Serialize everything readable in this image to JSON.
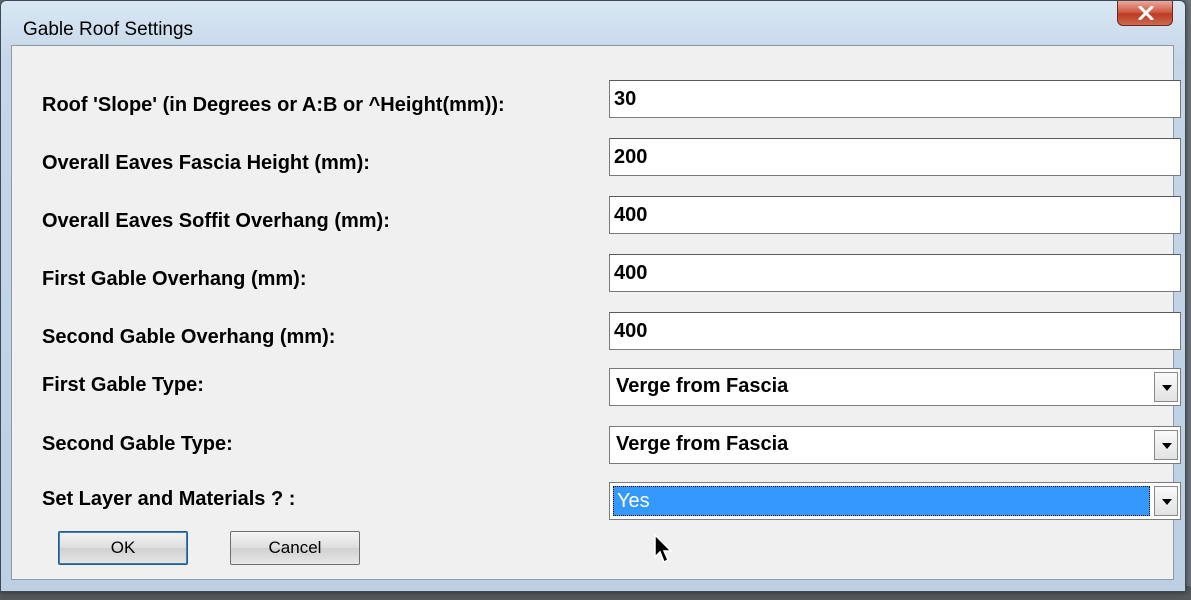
{
  "window": {
    "title": "Gable Roof Settings"
  },
  "fields": [
    {
      "label": "Roof 'Slope' (in Degrees or A:B or ^Height(mm)):",
      "value": "30"
    },
    {
      "label": "Overall Eaves Fascia Height (mm):",
      "value": "200"
    },
    {
      "label": "Overall Eaves Soffit Overhang (mm):",
      "value": "400"
    },
    {
      "label": "First Gable Overhang (mm):",
      "value": "400"
    },
    {
      "label": "Second Gable Overhang (mm):",
      "value": "400"
    }
  ],
  "selects": [
    {
      "label": "First Gable Type:",
      "value": "Verge from Fascia"
    },
    {
      "label": "Second Gable Type:",
      "value": "Verge from Fascia"
    },
    {
      "label": "Set Layer and Materials ? :",
      "value": "Yes"
    }
  ],
  "buttons": {
    "ok": "OK",
    "cancel": "Cancel"
  },
  "icons": {
    "close": "close-icon",
    "dropdown": "chevron-down-icon",
    "cursor": "mouse-pointer-icon"
  },
  "colors": {
    "selection": "#3399ff",
    "close_button": "#c8472f"
  }
}
